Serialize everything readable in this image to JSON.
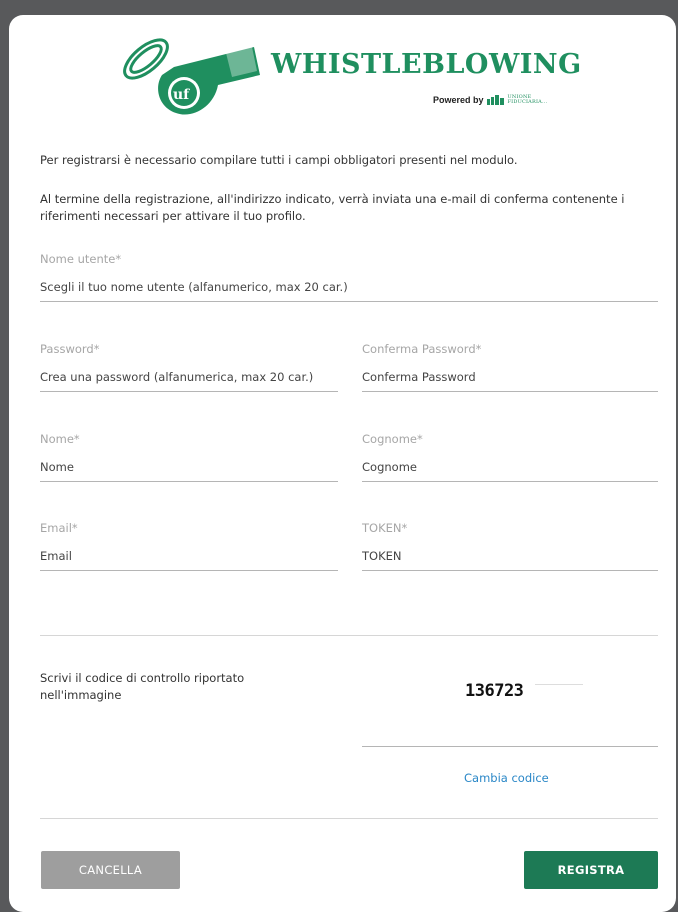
{
  "header": {
    "brand": "WHISTLEBLOWING",
    "powered_by": "Powered by",
    "partner_line1": "UNIONE",
    "partner_line2": "FIDUCIARIA...",
    "brand_color": "#1f8f5f"
  },
  "intro": {
    "line1": "Per registrarsi è necessario compilare tutti i campi obbligatori presenti nel modulo.",
    "line2": "Al termine della registrazione, all'indirizzo indicato, verrà inviata una e-mail di conferma contenente i riferimenti necessari per attivare il tuo profilo."
  },
  "fields": {
    "username": {
      "label": "Nome utente*",
      "placeholder": "Scegli il tuo nome utente (alfanumerico, max 20 car.)"
    },
    "password": {
      "label": "Password*",
      "placeholder": "Crea una password (alfanumerica, max 20 car.)"
    },
    "confirm_password": {
      "label": "Conferma Password*",
      "placeholder": "Conferma Password"
    },
    "first_name": {
      "label": "Nome*",
      "placeholder": "Nome"
    },
    "last_name": {
      "label": "Cognome*",
      "placeholder": "Cognome"
    },
    "email": {
      "label": "Email*",
      "placeholder": "Email"
    },
    "token": {
      "label": "TOKEN*",
      "placeholder": "TOKEN"
    }
  },
  "captcha": {
    "instruction": "Scrivi il codice di controllo riportato nell'immagine",
    "code": "136723",
    "change_label": "Cambia codice"
  },
  "buttons": {
    "cancel": "CANCELLA",
    "submit": "REGISTRA"
  },
  "colors": {
    "accent": "#1d7a55",
    "link": "#2a87c7",
    "cancel_bg": "#9e9e9e"
  }
}
